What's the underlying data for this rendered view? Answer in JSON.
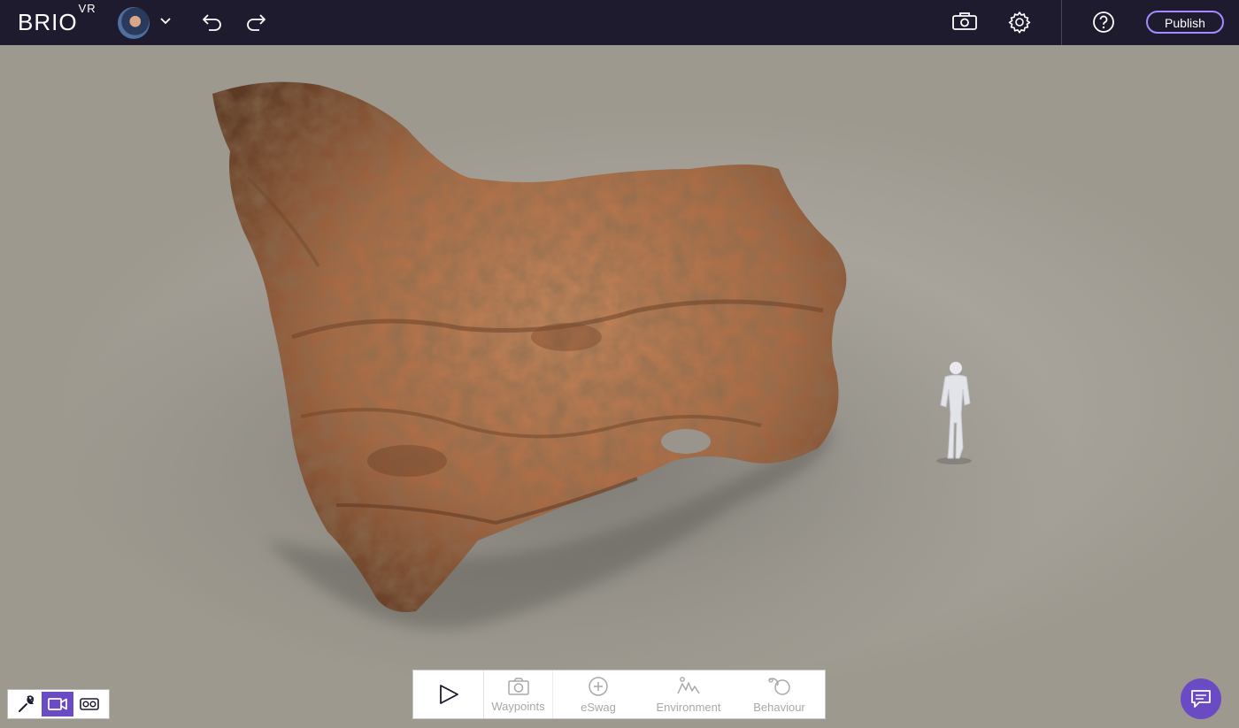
{
  "app": {
    "logo_text": "BRIO",
    "logo_superscript": "VR"
  },
  "topbar": {
    "avatar_icon": "user-avatar",
    "dropdown_icon": "chevron-down-icon",
    "undo_icon": "undo-icon",
    "redo_icon": "redo-icon",
    "preview_icon": "vr-headset-icon",
    "settings_icon": "gear-icon",
    "help_icon": "question-icon",
    "publish_label": "Publish"
  },
  "toolbar": {
    "play_icon": "play-icon",
    "items": [
      {
        "label": "Waypoints",
        "icon": "camera-icon"
      },
      {
        "label": "eSwag",
        "icon": "plus-circle-icon"
      },
      {
        "label": "Environment",
        "icon": "environment-icon"
      },
      {
        "label": "Behaviour",
        "icon": "behaviour-icon"
      }
    ]
  },
  "modes": {
    "items": [
      {
        "icon": "wrench-icon",
        "active": false
      },
      {
        "icon": "video-camera-icon",
        "active": true
      },
      {
        "icon": "vr-goggles-icon",
        "active": false
      }
    ]
  },
  "colors": {
    "topbar_bg": "#1e1b2e",
    "accent": "#6a4bc4",
    "publish_border": "#a58bff",
    "viewport_bg": "#a9a59d",
    "rock": "#a86a44"
  }
}
